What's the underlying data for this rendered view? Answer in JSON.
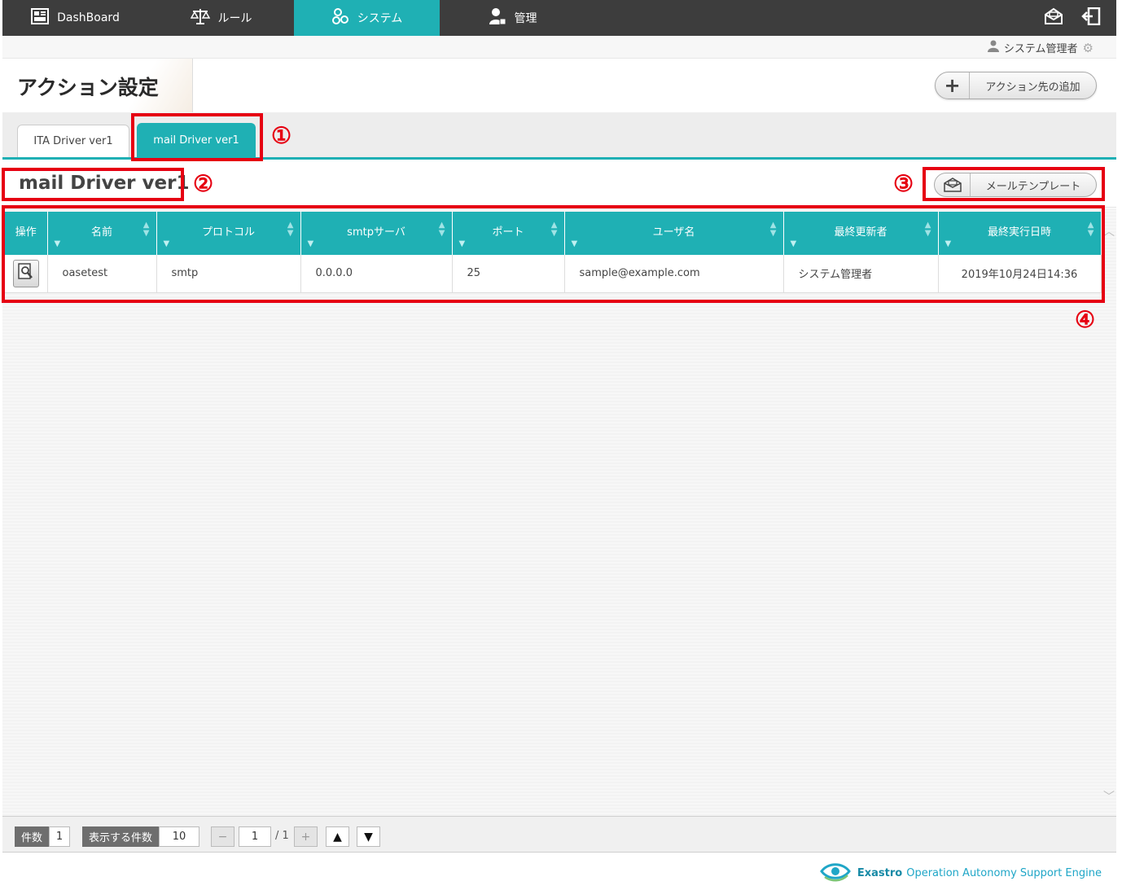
{
  "nav": {
    "items": [
      {
        "label": "DashBoard",
        "icon": "dashboard-icon"
      },
      {
        "label": "ルール",
        "icon": "scale-icon"
      },
      {
        "label": "システム",
        "icon": "system-gears-icon"
      },
      {
        "label": "管理",
        "icon": "admin-user-icon"
      }
    ],
    "active_index": 2
  },
  "user": {
    "name": "システム管理者"
  },
  "page": {
    "title": "アクション設定",
    "add_button": "アクション先の追加"
  },
  "tabs": [
    {
      "label": "ITA Driver ver1"
    },
    {
      "label": "mail Driver ver1"
    }
  ],
  "section": {
    "title": "mail Driver ver1",
    "template_button": "メールテンプレート"
  },
  "table": {
    "headers": [
      "操作",
      "名前",
      "プロトコル",
      "smtpサーバ",
      "ポート",
      "ユーザ名",
      "最終更新者",
      "最終実行日時"
    ],
    "rows": [
      {
        "name": "oasetest",
        "protocol": "smtp",
        "server": "0.0.0.0",
        "port": "25",
        "user": "sample@example.com",
        "updater": "システム管理者",
        "last_run": "2019年10月24日14:36"
      }
    ]
  },
  "pager": {
    "count_label": "件数",
    "count": "1",
    "per_page_label": "表示する件数",
    "per_page": "10",
    "page": "1",
    "total_pages": "/ 1"
  },
  "brand": {
    "name": "Exastro",
    "tagline": "Operation Autonomy Support Engine"
  },
  "annotations": [
    "①",
    "②",
    "③",
    "④"
  ],
  "colors": {
    "accent": "#1fb0b4",
    "nav_bg": "#3d3d3d",
    "annotation": "#e60012"
  }
}
